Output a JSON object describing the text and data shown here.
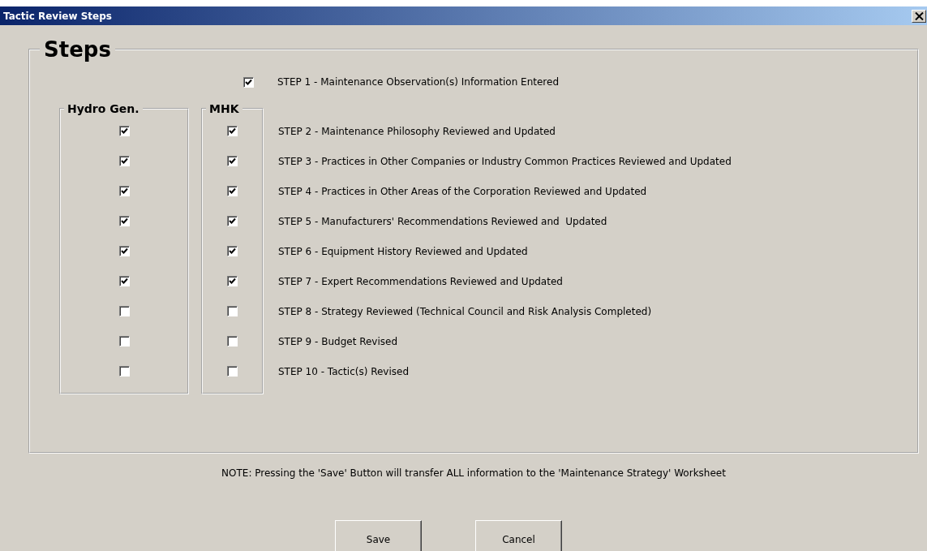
{
  "window": {
    "title": "Tactic Review Steps"
  },
  "steps_group": {
    "title": "Steps",
    "first_step": {
      "label": "STEP 1 - Maintenance Observation(s) Information Entered",
      "checked": true
    },
    "columns": [
      {
        "title": "Hydro Gen."
      },
      {
        "title": "MHK"
      }
    ],
    "steps": [
      {
        "label": "STEP 2 - Maintenance Philosophy Reviewed and Updated",
        "checks": [
          true,
          true
        ]
      },
      {
        "label": "STEP 3 - Practices in Other Companies or Industry Common Practices Reviewed and Updated",
        "checks": [
          true,
          true
        ]
      },
      {
        "label": "STEP 4 - Practices in Other Areas of the Corporation Reviewed and Updated",
        "checks": [
          true,
          true
        ]
      },
      {
        "label": "STEP 5 - Manufacturers' Recommendations Reviewed and  Updated",
        "checks": [
          true,
          true
        ]
      },
      {
        "label": "STEP 6 - Equipment History Reviewed and Updated",
        "checks": [
          true,
          true
        ]
      },
      {
        "label": "STEP 7 - Expert Recommendations Reviewed and Updated",
        "checks": [
          true,
          true
        ]
      },
      {
        "label": "STEP 8 - Strategy Reviewed (Technical Council and Risk Analysis Completed)",
        "checks": [
          false,
          false
        ]
      },
      {
        "label": "STEP 9 - Budget Revised",
        "checks": [
          false,
          false
        ]
      },
      {
        "label": "STEP 10 - Tactic(s) Revised",
        "checks": [
          false,
          false
        ]
      }
    ]
  },
  "note": "NOTE: Pressing the 'Save' Button will transfer ALL information to the 'Maintenance Strategy' Worksheet",
  "buttons": [
    "Save",
    "Cancel"
  ]
}
